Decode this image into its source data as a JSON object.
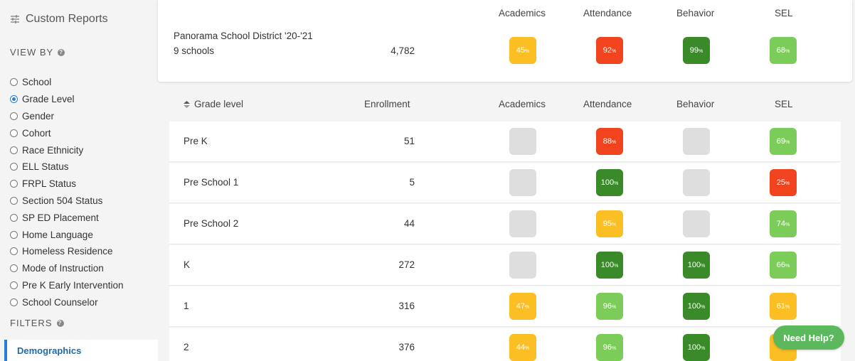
{
  "sidebar": {
    "title": "Custom Reports",
    "title_icon": "sliders-icon",
    "view_by_label": "VIEW BY",
    "filters_label": "FILTERS",
    "view_by_options": [
      {
        "label": "School",
        "selected": false
      },
      {
        "label": "Grade Level",
        "selected": true
      },
      {
        "label": "Gender",
        "selected": false
      },
      {
        "label": "Cohort",
        "selected": false
      },
      {
        "label": "Race Ethnicity",
        "selected": false
      },
      {
        "label": "ELL Status",
        "selected": false
      },
      {
        "label": "FRPL Status",
        "selected": false
      },
      {
        "label": "Section 504 Status",
        "selected": false
      },
      {
        "label": "SP ED Placement",
        "selected": false
      },
      {
        "label": "Home Language",
        "selected": false
      },
      {
        "label": "Homeless Residence",
        "selected": false
      },
      {
        "label": "Mode of Instruction",
        "selected": false
      },
      {
        "label": "Pre K Early Intervention",
        "selected": false
      },
      {
        "label": "School Counselor",
        "selected": false
      }
    ],
    "filter_tab": "Demographics"
  },
  "summary": {
    "headers": [
      "Academics",
      "Attendance",
      "Behavior",
      "SEL"
    ],
    "district_name": "Panorama School District '20-'21",
    "district_sub": "9 schools",
    "enrollment": "4,782",
    "badges": [
      {
        "value": "45",
        "color": "#fbbf24"
      },
      {
        "value": "92",
        "color": "#f0431e"
      },
      {
        "value": "99",
        "color": "#3a8a2a"
      },
      {
        "value": "68",
        "color": "#7ccc5a"
      }
    ]
  },
  "table": {
    "sort_col": "Grade level",
    "headers": [
      "Enrollment",
      "Academics",
      "Attendance",
      "Behavior",
      "SEL"
    ],
    "rows": [
      {
        "label": "Pre K",
        "enrollment": "51",
        "cells": [
          null,
          {
            "value": "88",
            "color": "#f0431e"
          },
          null,
          {
            "value": "69",
            "color": "#7ccc5a"
          }
        ]
      },
      {
        "label": "Pre School 1",
        "enrollment": "5",
        "cells": [
          null,
          {
            "value": "100",
            "color": "#3a8a2a"
          },
          null,
          {
            "value": "25",
            "color": "#f0431e"
          }
        ]
      },
      {
        "label": "Pre School 2",
        "enrollment": "44",
        "cells": [
          null,
          {
            "value": "95",
            "color": "#fbbf24"
          },
          null,
          {
            "value": "74",
            "color": "#7ccc5a"
          }
        ]
      },
      {
        "label": "K",
        "enrollment": "272",
        "cells": [
          null,
          {
            "value": "100",
            "color": "#3a8a2a"
          },
          {
            "value": "100",
            "color": "#3a8a2a"
          },
          {
            "value": "66",
            "color": "#7ccc5a"
          }
        ]
      },
      {
        "label": "1",
        "enrollment": "316",
        "cells": [
          {
            "value": "47",
            "color": "#fbbf24"
          },
          {
            "value": "96",
            "color": "#7ccc5a"
          },
          {
            "value": "100",
            "color": "#3a8a2a"
          },
          {
            "value": "61",
            "color": "#fbbf24"
          }
        ]
      },
      {
        "label": "2",
        "enrollment": "376",
        "cells": [
          {
            "value": "44",
            "color": "#fbbf24"
          },
          {
            "value": "96",
            "color": "#7ccc5a"
          },
          {
            "value": "100",
            "color": "#3a8a2a"
          },
          {
            "value": "",
            "color": "#fbbf24"
          }
        ]
      }
    ]
  },
  "pct_symbol": "%",
  "need_help": "Need Help?",
  "empty_color": "#dedede"
}
